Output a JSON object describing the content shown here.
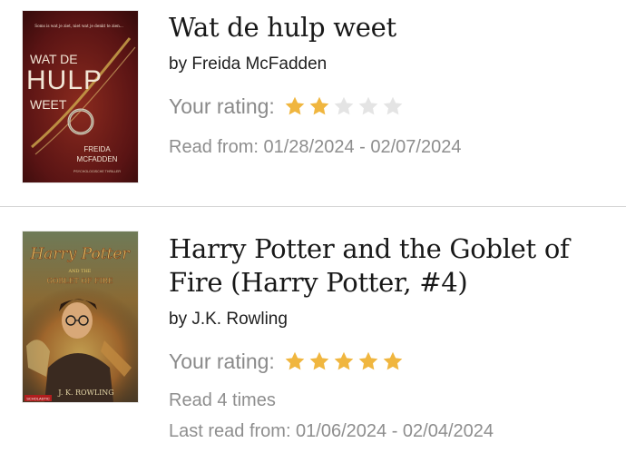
{
  "books": [
    {
      "cover": {
        "tagline": "Soms is wat je ziet, niet wat je denkt te zien...",
        "title_line1": "WAT DE",
        "title_line2": "HULP",
        "title_line3": "WEET",
        "author_line1": "FREIDA",
        "author_line2": "MCFADDEN",
        "footer": "PSYCHOLOGISCHE THRILLER",
        "colors": {
          "background": "#5a1414",
          "accent": "#c9a24a",
          "text": "#f2e6d6"
        }
      },
      "title": "Wat de hulp weet",
      "author": "by Freida McFadden",
      "rating_label": "Your rating:",
      "rating": 2,
      "max_rating": 5,
      "read_info": "Read from: 01/28/2024 - 02/07/2024"
    },
    {
      "cover": {
        "title_line1": "Harry Potter",
        "title_line2": "AND THE",
        "title_line3": "GOBLET OF FIRE",
        "author": "J. K. ROWLING",
        "publisher": "SCHOLASTIC",
        "colors": {
          "background": "#7a6a3a",
          "accent": "#d8b24a",
          "text": "#f3e1a0"
        }
      },
      "title": "Harry Potter and the Goblet of Fire (Harry Potter, #4)",
      "author": "by J.K. Rowling",
      "rating_label": "Your rating:",
      "rating": 5,
      "max_rating": 5,
      "read_count": "Read 4 times",
      "read_info": "Last read from: 01/06/2024 - 02/04/2024"
    }
  ],
  "colors": {
    "star_filled": "#f0b63f",
    "star_empty": "#e4e4e4"
  }
}
